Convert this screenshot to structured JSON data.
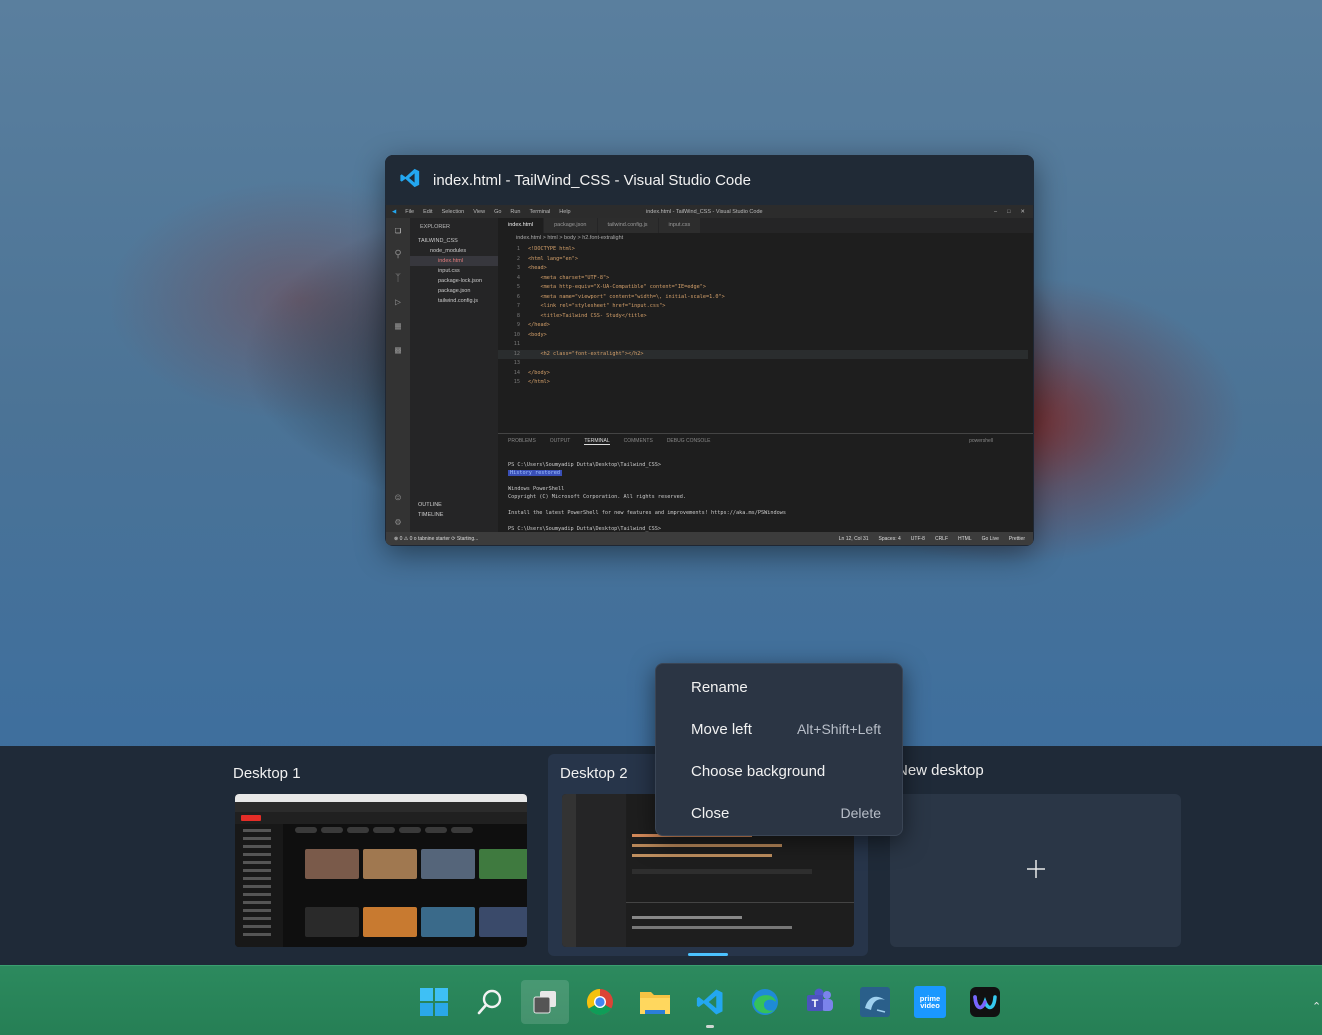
{
  "window": {
    "title": "index.html - TailWind_CSS - Visual Studio Code",
    "vscode": {
      "menu": [
        "File",
        "Edit",
        "Selection",
        "View",
        "Go",
        "Run",
        "Terminal",
        "Help"
      ],
      "center_title": "index.html - TailWind_CSS - Visual Studio Code",
      "explorer_label": "EXPLORER",
      "project_label": "TAILWIND_CSS",
      "files": [
        "node_modules",
        "index.html",
        "input.css",
        "package-lock.json",
        "package.json",
        "tailwind.config.js"
      ],
      "outline_label": "OUTLINE",
      "timeline_label": "TIMELINE",
      "tabs": [
        "index.html",
        "package.json",
        "tailwind.config.js",
        "input.css"
      ],
      "breadcrumb": "index.html > html > body > h2.font-extralight",
      "code_lines": [
        "<!DOCTYPE html>",
        "<html lang=\"en\">",
        "<head>",
        "    <meta charset=\"UTF-8\">",
        "    <meta http-equiv=\"X-UA-Compatible\" content=\"IE=edge\">",
        "    <meta name=\"viewport\" content=\"width=\\, initial-scale=1.0\">",
        "    <link rel=\"stylesheet\" href=\"input.css\">",
        "    <title>Tailwind CSS- Study</title>",
        "</head>",
        "<body>",
        "",
        "    <h2 class=\"font-extralight\"></h2>",
        "",
        "</body>",
        "</html>"
      ],
      "panel_tabs": [
        "PROBLEMS",
        "OUTPUT",
        "TERMINAL",
        "COMMENTS",
        "DEBUG CONSOLE"
      ],
      "shell_label": "powershell",
      "terminal": {
        "prompt1": "PS C:\\Users\\Soumyadip Dutta\\Desktop\\Tailwind_CSS>",
        "history": "History restored",
        "line1": "Windows PowerShell",
        "line2": "Copyright (C) Microsoft Corporation. All rights reserved.",
        "line3": "Install the latest PowerShell for new features and improvements! https://aka.ms/PSWindows",
        "prompt2": "PS C:\\Users\\Soumyadip Dutta\\Desktop\\Tailwind_CSS>"
      },
      "status_left": "⊗ 0 ⚠ 0     o tabnine starter ⟳ Starting...",
      "status_right": [
        "Ln 12, Col 31",
        "Spaces: 4",
        "UTF-8",
        "CRLF",
        "HTML",
        "Go Live",
        "Prettier"
      ]
    }
  },
  "desktops": {
    "desktop1_label": "Desktop 1",
    "desktop2_label": "Desktop 2",
    "new_desktop_label": "New desktop"
  },
  "context_menu": {
    "items": [
      {
        "label": "Rename",
        "shortcut": ""
      },
      {
        "label": "Move left",
        "shortcut": "Alt+Shift+Left"
      },
      {
        "label": "Choose background",
        "shortcut": ""
      },
      {
        "label": "Close",
        "shortcut": "Delete"
      }
    ]
  },
  "taskbar": {
    "icons": [
      "windows-start-icon",
      "search-icon",
      "task-view-icon",
      "chrome-icon",
      "file-explorer-icon",
      "vscode-icon",
      "edge-icon",
      "teams-icon",
      "mysql-workbench-icon",
      "prime-video-icon",
      "webex-icon"
    ],
    "prime_video_text": "prime video"
  },
  "colors": {
    "accent": "#4cc2ff",
    "taskbar": "#2a875b",
    "menu_bg": "#2b3544",
    "tv_bar": "#1f2a38"
  }
}
